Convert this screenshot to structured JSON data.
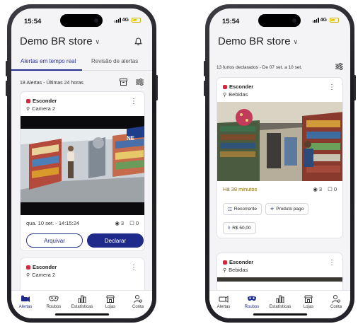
{
  "left_phone": {
    "status": {
      "time": "15:54",
      "network": "4G"
    },
    "store_title": "Demo BR store",
    "tabs": [
      {
        "label": "Alertas em tempo real",
        "active": true
      },
      {
        "label": "Revisão de alertas",
        "active": false
      }
    ],
    "summary": "18 Alertas - Últimas 24 horas",
    "cards": [
      {
        "tag": "Esconder",
        "camera": "Camera 2",
        "timestamp": "qua. 10 set. - 14:15:24",
        "views": "3",
        "comments": "0",
        "secondary_action": "Arquivar",
        "primary_action": "Declarar"
      },
      {
        "tag": "Esconder",
        "camera": "Camera 2"
      }
    ],
    "nav": [
      {
        "label": "Alertas",
        "icon": "alert-icon",
        "active": true
      },
      {
        "label": "Roubos",
        "icon": "mask-icon",
        "active": false
      },
      {
        "label": "Estatísticas",
        "icon": "stats-icon",
        "active": false
      },
      {
        "label": "Lojas",
        "icon": "store-icon",
        "active": false
      },
      {
        "label": "Conta",
        "icon": "account-icon",
        "active": false
      }
    ]
  },
  "right_phone": {
    "status": {
      "time": "15:54",
      "network": "4G"
    },
    "store_title": "Demo BR store",
    "summary": "13 furtos declarados - De 07 set. a 10 set.",
    "cards": [
      {
        "tag": "Esconder",
        "category": "Bebidas",
        "elapsed": "Há 38 minutos",
        "views": "3",
        "comments": "0",
        "chips": [
          "Recorrente",
          "Produto pago",
          "R$ 50,00"
        ]
      },
      {
        "tag": "Esconder",
        "category": "Bebidas"
      }
    ],
    "nav": [
      {
        "label": "Alertas",
        "icon": "alert-icon",
        "active": false
      },
      {
        "label": "Roubos",
        "icon": "mask-icon",
        "active": true
      },
      {
        "label": "Estatísticas",
        "icon": "stats-icon",
        "active": false
      },
      {
        "label": "Lojas",
        "icon": "store-icon",
        "active": false
      },
      {
        "label": "Conta",
        "icon": "account-icon",
        "active": false
      }
    ]
  },
  "colors": {
    "primary": "#1f2a8a",
    "alert_red": "#d7263d",
    "elapsed_text": "#8a6d00",
    "background": "#f4f4f6"
  }
}
